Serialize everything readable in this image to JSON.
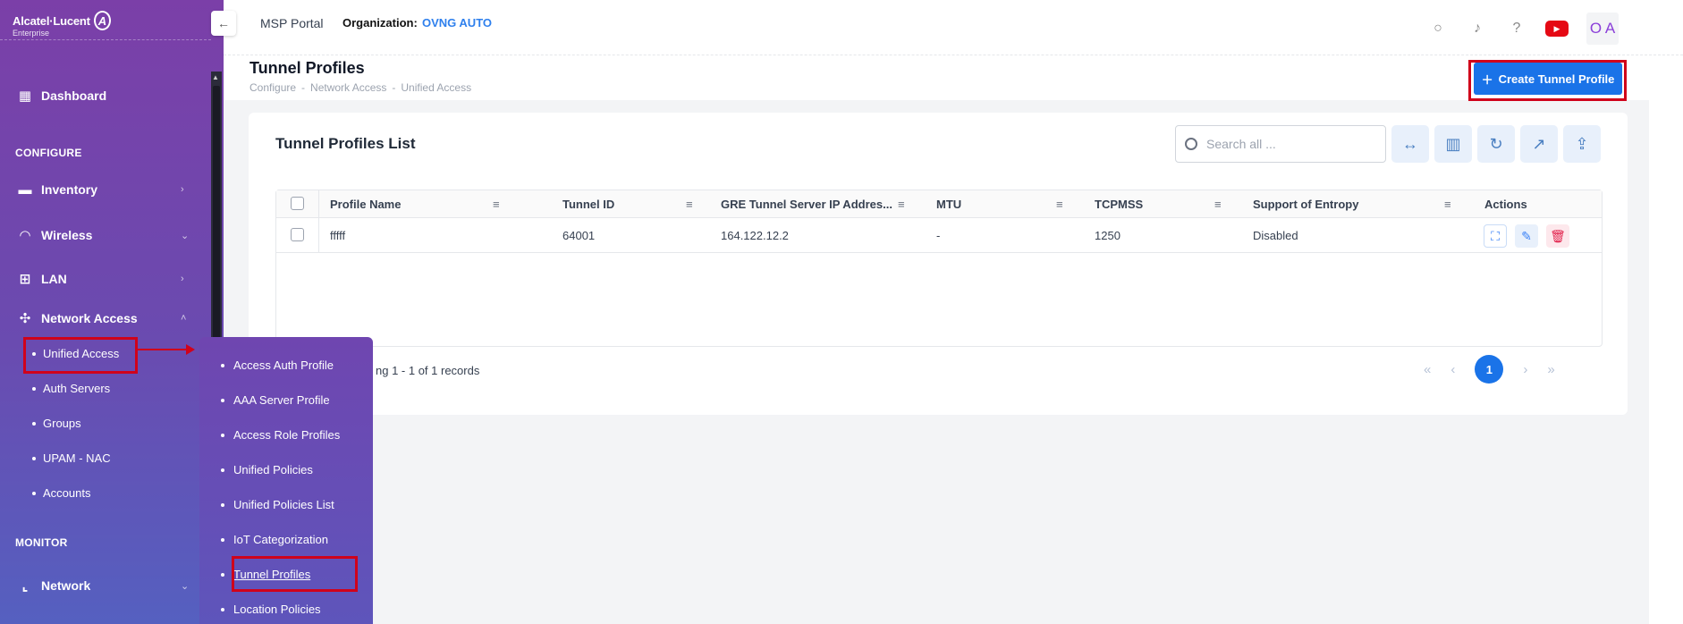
{
  "brand": {
    "name": "Alcatel·Lucent",
    "sub": "Enterprise",
    "mark": "A"
  },
  "sidebar": {
    "dashboard": "Dashboard",
    "configure_title": "CONFIGURE",
    "items": [
      {
        "label": "Inventory"
      },
      {
        "label": "Wireless"
      },
      {
        "label": "LAN"
      },
      {
        "label": "Network Access"
      }
    ],
    "network_access_children": [
      "Unified Access",
      "Auth Servers",
      "Groups",
      "UPAM - NAC",
      "Accounts"
    ],
    "monitor_title": "MONITOR",
    "network": "Network"
  },
  "flyout": {
    "items": [
      "Access Auth Profile",
      "AAA Server Profile",
      "Access Role Profiles",
      "Unified Policies",
      "Unified Policies List",
      "IoT Categorization",
      "Tunnel Profiles",
      "Location Policies"
    ],
    "active": "Tunnel Profiles"
  },
  "topbar": {
    "portal": "MSP Portal",
    "org_label": "Organization:",
    "org_value": "OVNG AUTO",
    "avatar": "O A",
    "icons": [
      "search-icon",
      "bell-icon",
      "help-icon",
      "youtube-icon"
    ]
  },
  "page": {
    "title": "Tunnel Profiles",
    "breadcrumb": [
      "Configure",
      "-",
      "Network Access",
      "-",
      "Unified Access"
    ],
    "create_button": "Create Tunnel Profile"
  },
  "list": {
    "title": "Tunnel Profiles List",
    "search_placeholder": "Search all ...",
    "columns": [
      "Profile Name",
      "Tunnel ID",
      "GRE Tunnel Server IP Addres...",
      "MTU",
      "TCPMSS",
      "Support of Entropy",
      "Actions"
    ],
    "rows": [
      {
        "profile_name": "fffff",
        "tunnel_id": "64001",
        "gre_ip": "164.122.12.2",
        "mtu": "-",
        "tcpmss": "1250",
        "entropy": "Disabled"
      }
    ],
    "paging_text": "ng 1 - 1 of 1 records",
    "current_page": "1"
  },
  "colors": {
    "accent": "#1a73e8",
    "highlight": "#d0021b",
    "sidebar_top": "#7b3fa8",
    "sidebar_bottom": "#5560c0"
  }
}
